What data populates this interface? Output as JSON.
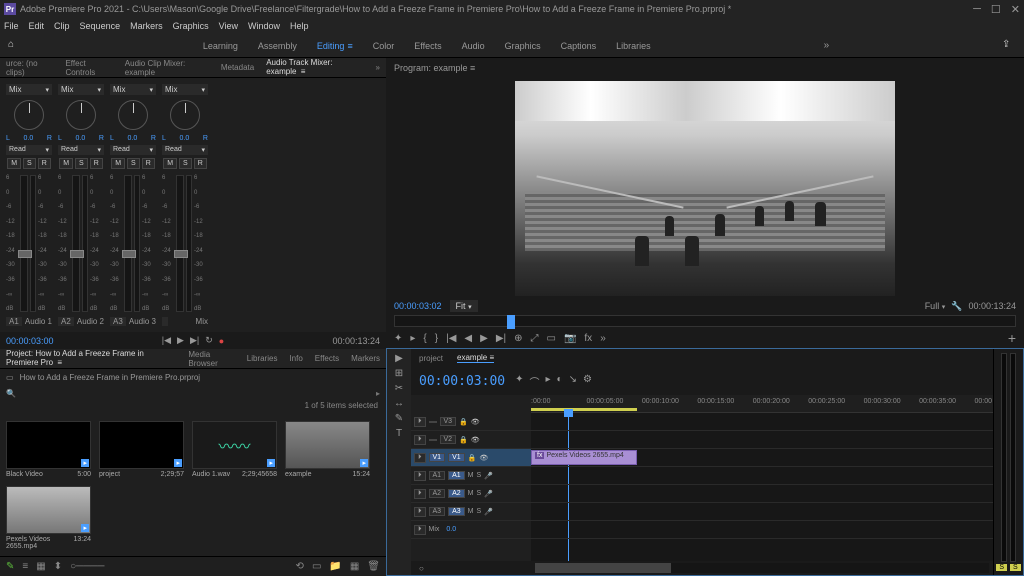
{
  "titlebar": {
    "app_icon": "Pr",
    "title": "Adobe Premiere Pro 2021 - C:\\Users\\Mason\\Google Drive\\Freelance\\Filtergrade\\How to Add a Freeze Frame in Premiere Pro\\How to Add a Freeze Frame in Premiere Pro.prproj *"
  },
  "menubar": [
    "File",
    "Edit",
    "Clip",
    "Sequence",
    "Markers",
    "Graphics",
    "View",
    "Window",
    "Help"
  ],
  "workspaces": [
    "Learning",
    "Assembly",
    "Editing",
    "Color",
    "Effects",
    "Audio",
    "Graphics",
    "Captions",
    "Libraries"
  ],
  "workspace_active": "Editing",
  "source_tabs": {
    "source": "urce: (no clips)",
    "effect_controls": "Effect Controls",
    "audio_clip_mixer": "Audio Clip Mixer: example",
    "metadata": "Metadata",
    "audio_track_mixer": "Audio Track Mixer: example"
  },
  "mixer": {
    "pan_label": "Mix",
    "pan_L": "L",
    "pan_R": "R",
    "pan_val": "0.0",
    "read": "Read",
    "db_marks": [
      "6",
      "0",
      "-6",
      "-12",
      "-18",
      "-24",
      "-30",
      "-36",
      "-∞",
      "dB"
    ],
    "channels": [
      {
        "id": "A1",
        "name": "Audio 1",
        "fader": 0.55
      },
      {
        "id": "A2",
        "name": "Audio 2",
        "fader": 0.55
      },
      {
        "id": "A3",
        "name": "Audio 3",
        "fader": 0.55
      },
      {
        "id": "",
        "name": "Mix",
        "fader": 0.55
      }
    ],
    "msr": [
      "M",
      "S",
      "R"
    ]
  },
  "transport_mini": {
    "tc_left": "00:00:03:00",
    "tc_right": "00:00:13:24",
    "buttons": [
      "|◀",
      "▶",
      "▶|",
      "↻",
      "●"
    ]
  },
  "project_tabs": {
    "project": "Project: How to Add a Freeze Frame in Premiere Pro",
    "media_browser": "Media Browser",
    "libraries": "Libraries",
    "info": "Info",
    "effects": "Effects",
    "markers": "Markers"
  },
  "project": {
    "path": "How to Add a Freeze Frame in Premiere Pro.prproj",
    "selected": "1 of 5 items selected",
    "items": [
      {
        "name": "Black Video",
        "dur": "5:00",
        "type": "black"
      },
      {
        "name": "project",
        "dur": "2;29;57",
        "type": "black"
      },
      {
        "name": "Audio 1.wav",
        "dur": "2;29;45658",
        "type": "audio"
      },
      {
        "name": "example",
        "dur": "15:24",
        "type": "video"
      },
      {
        "name": "Pexels Videos 2655.mp4",
        "dur": "13:24",
        "type": "video2"
      }
    ]
  },
  "program": {
    "tab": "Program: example",
    "tc_left": "00:00:03:02",
    "fit": "Fit",
    "full": "Full",
    "tc_right": "00:00:13:24",
    "buttons": [
      "✦",
      "▸",
      "{",
      "}",
      "|◀",
      "◀",
      "▶",
      "▶|",
      "⊕",
      "⤢",
      "▭",
      "📷",
      "fx",
      "»"
    ]
  },
  "timeline": {
    "tabs": {
      "project": "project",
      "example": "example"
    },
    "tc": "00:00:03:00",
    "icons": [
      "✦",
      "⌒",
      "▸",
      "◐",
      "↘",
      "⚙"
    ],
    "ruler": [
      ":00:00",
      "00:00:05:00",
      "00:00:10:00",
      "00:00:15:00",
      "00:00:20:00",
      "00:00:25:00",
      "00:00:30:00",
      "00:00:35:00",
      "00:00"
    ],
    "tracks": {
      "v3": {
        "label": "V3",
        "type": "video"
      },
      "v2": {
        "label": "V2",
        "type": "video"
      },
      "v1": {
        "label": "V1",
        "src": "V1",
        "type": "video",
        "active": true,
        "clip": {
          "name": "Pexels Videos 2655.mp4",
          "start": 0,
          "end": 23
        }
      },
      "a1": {
        "label": "A1",
        "src": "A1",
        "type": "audio"
      },
      "a2": {
        "label": "A2",
        "src": "A2",
        "type": "audio"
      },
      "a3": {
        "label": "A3",
        "src": "A3",
        "type": "audio"
      },
      "mix": {
        "label": "Mix",
        "val": "0.0"
      }
    },
    "tools": [
      "▶",
      "⊞",
      "✂",
      "↔",
      "✎",
      "T"
    ],
    "zoom": "○"
  },
  "meters": {
    "S": "S"
  }
}
